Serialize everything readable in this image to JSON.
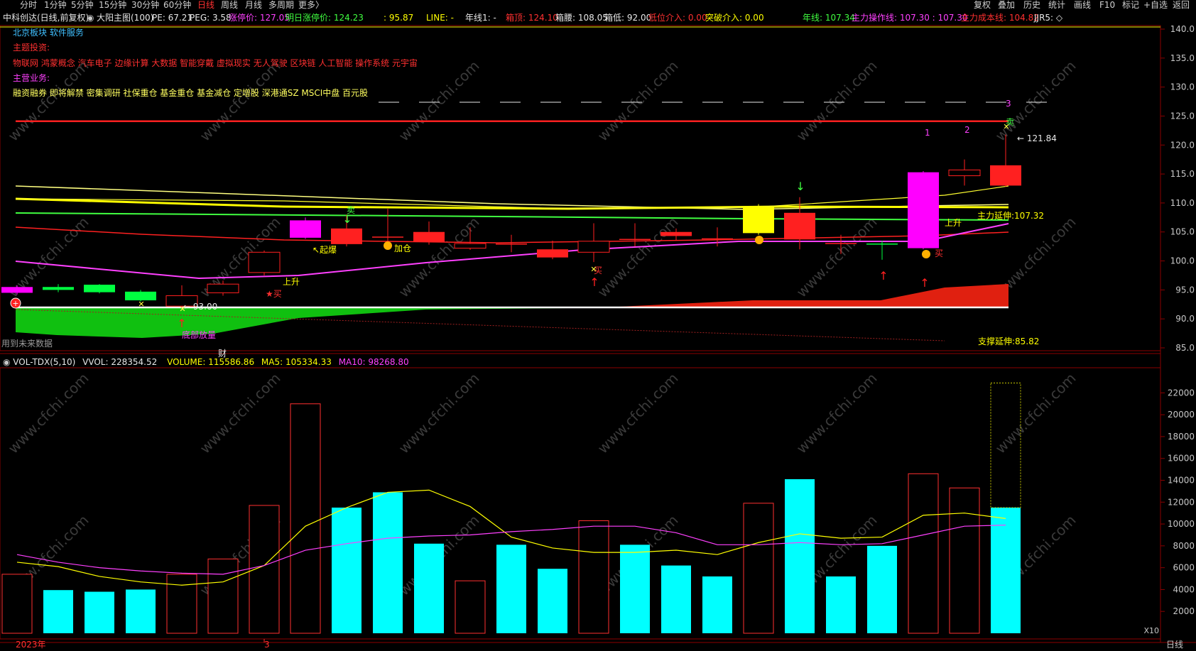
{
  "toolbar": {
    "periods": [
      "分时",
      "1分钟",
      "5分钟",
      "15分钟",
      "30分钟",
      "60分钟",
      "日线",
      "周线",
      "月线",
      "多周期",
      "更多〉"
    ],
    "active_period": "日线",
    "right_buttons": [
      "复权",
      "叠加",
      "历史",
      "统计",
      "画线",
      "F10",
      "标记",
      "+自选",
      "返回"
    ]
  },
  "info": {
    "stock": "中科创达(日线,前复权)",
    "indicator": "大阳主图(100)",
    "pe": "PE: 67.21",
    "peg": "PEG: 3.58",
    "limit_up": "涨停价: 127.05",
    "next_limit_up": "明日涨停价: 124.23",
    "blank_val": ": 95.87",
    "line": "LINE: -",
    "year_line1": "年线1: -",
    "top_box": "箱顶: 124.10",
    "waist_box": "箱腰: 108.05",
    "bottom_box": "箱低: 92.00",
    "low_entry": "低位介入: 0.00",
    "break_entry": "突破介入: 0.00",
    "year_line": "年线: 107.34",
    "main_line": "主力操作线: 107.30 : 107.30",
    "main_cost": "主力成本线: 104.82",
    "jjr": "JJR5: ◇"
  },
  "overlay": {
    "sector": "北京板块  软件服务",
    "theme_title": "主题投资:",
    "themes": "物联网  鸿蒙概念  汽车电子  边缘计算  大数据  智能穿戴  虚拟现实  无人驾驶  区块链  人工智能  操作系统  元宇宙",
    "biz_title": "主营业务:",
    "tags": "融资融券  即将解禁  密集调研  社保重仓  基金重仓  基金减仓  定增股  深港通SZ  MSCI中盘  百元股",
    "future_data": "用到未来数据",
    "fin": "财"
  },
  "labels": {
    "peak_value": "121.84",
    "low_value": "93.00",
    "main_extend": "主力延伸:107.32",
    "support_extend": "支撑延伸:85.82",
    "qibao": "起爆",
    "jiacang": "加仓",
    "shangsheng1": "上升",
    "shangsheng2": "上升",
    "mai1": "买",
    "mai2": "买",
    "mai3": "买",
    "mai4": "买",
    "mai5": "买",
    "mai_big": "卖",
    "mai_top": "卖",
    "num1": "1",
    "num2": "2",
    "num3": "3",
    "bottom_tag": "底部放量"
  },
  "vol_header": {
    "name": "VOL-TDX(5,10)",
    "vvol": "VVOL: 228354.52",
    "volume": "VOLUME: 115586.86",
    "ma5": "MA5: 105334.33",
    "ma10": "MA10: 98268.80"
  },
  "axis": {
    "price_ticks": [
      "140.0",
      "135.0",
      "130.0",
      "125.0",
      "120.0",
      "115.0",
      "110.0",
      "105.0",
      "100.0",
      "95.0",
      "90.0",
      "85.0"
    ],
    "vol_ticks": [
      "22000",
      "20000",
      "18000",
      "16000",
      "14000",
      "12000",
      "10000",
      "8000",
      "6000",
      "4000",
      "2000"
    ],
    "x10": "X10",
    "year": "2023年",
    "month": "3",
    "period_label": "日线"
  },
  "colors": {
    "up": "#ff2020",
    "down": "#00ff40",
    "vol_down": "#00ffff",
    "magenta": "#ff00ff",
    "yellow": "#ffff00"
  },
  "chart_data": {
    "type": "candlestick",
    "price_range": [
      84,
      142
    ],
    "candles": [
      {
        "o": 95.5,
        "c": 94.5,
        "h": 95.8,
        "l": 94.2,
        "kind": "m"
      },
      {
        "o": 95.5,
        "c": 95.0,
        "h": 96.0,
        "l": 94.6,
        "kind": "g"
      },
      {
        "o": 95.9,
        "c": 94.6,
        "h": 96.0,
        "l": 94.4,
        "kind": "g"
      },
      {
        "o": 94.7,
        "c": 93.2,
        "h": 95.0,
        "l": 93.0,
        "kind": "g"
      },
      {
        "o": 94.0,
        "c": 92.2,
        "h": 95.8,
        "l": 92.0,
        "kind": "h"
      },
      {
        "o": 94.5,
        "c": 96.0,
        "h": 96.6,
        "l": 94.0,
        "kind": "h"
      },
      {
        "o": 98.0,
        "c": 101.5,
        "h": 101.8,
        "l": 97.5,
        "kind": "h"
      },
      {
        "o": 104.0,
        "c": 107.0,
        "h": 107.5,
        "l": 103.8,
        "kind": "m"
      },
      {
        "o": 105.6,
        "c": 102.9,
        "h": 108.0,
        "l": 102.5,
        "kind": "r"
      },
      {
        "o": 104.2,
        "c": 104.2,
        "h": 109.0,
        "l": 102.5,
        "kind": "r"
      },
      {
        "o": 105.0,
        "c": 103.3,
        "h": 106.8,
        "l": 102.8,
        "kind": "r"
      },
      {
        "o": 103.0,
        "c": 102.2,
        "h": 105.8,
        "l": 101.9,
        "kind": "h"
      },
      {
        "o": 103.0,
        "c": 103.0,
        "h": 104.5,
        "l": 101.5,
        "kind": "r"
      },
      {
        "o": 102.0,
        "c": 100.6,
        "h": 103.5,
        "l": 100.3,
        "kind": "r"
      },
      {
        "o": 101.5,
        "c": 103.4,
        "h": 106.5,
        "l": 99.8,
        "kind": "h"
      },
      {
        "o": 103.8,
        "c": 103.8,
        "h": 106.5,
        "l": 102.5,
        "kind": "r"
      },
      {
        "o": 105.0,
        "c": 104.3,
        "h": 105.6,
        "l": 103.5,
        "kind": "r"
      },
      {
        "o": 103.9,
        "c": 103.9,
        "h": 105.8,
        "l": 102.5,
        "kind": "r"
      },
      {
        "o": 104.8,
        "c": 109.4,
        "h": 109.8,
        "l": 104.5,
        "kind": "y"
      },
      {
        "o": 103.7,
        "c": 108.3,
        "h": 111.0,
        "l": 102.0,
        "kind": "r"
      },
      {
        "o": 103.1,
        "c": 103.1,
        "h": 104.5,
        "l": 101.2,
        "kind": "r"
      },
      {
        "o": 103.0,
        "c": 103.0,
        "h": 103.5,
        "l": 100.2,
        "kind": "g"
      },
      {
        "o": 102.2,
        "c": 115.3,
        "h": 115.5,
        "l": 102.0,
        "kind": "m"
      },
      {
        "o": 114.7,
        "c": 115.7,
        "h": 117.5,
        "l": 113.0,
        "kind": "h"
      },
      {
        "o": 113.0,
        "c": 116.5,
        "h": 121.8,
        "l": 112.8,
        "kind": "r"
      }
    ],
    "volumes": [
      5400,
      3950,
      3800,
      4000,
      5400,
      6800,
      11700,
      21000,
      11500,
      12900,
      8200,
      4800,
      8100,
      5900,
      10300,
      8100,
      6200,
      5200,
      11900,
      14100,
      5200,
      8000,
      14600,
      13300,
      11500
    ],
    "vol_kind": [
      "h",
      "c",
      "c",
      "c",
      "h",
      "h",
      "h",
      "h",
      "c",
      "c",
      "c",
      "h",
      "c",
      "c",
      "h",
      "c",
      "c",
      "c",
      "h",
      "c",
      "c",
      "c",
      "h",
      "h",
      "c"
    ],
    "ma5": [
      6500,
      6100,
      5200,
      4700,
      4400,
      4700,
      6200,
      9800,
      11500,
      12900,
      13100,
      11600,
      8800,
      7800,
      7400,
      7400,
      7600,
      7200,
      8300,
      9100,
      8700,
      8800,
      10800,
      11000,
      10500
    ],
    "ma10": [
      7200,
      6500,
      6000,
      5700,
      5500,
      5400,
      6200,
      7600,
      8200,
      8700,
      8900,
      9000,
      9300,
      9500,
      9800,
      9800,
      9200,
      8100,
      8100,
      8300,
      8100,
      8200,
      9000,
      9800,
      9900
    ],
    "vol_range": [
      0,
      23500
    ]
  }
}
